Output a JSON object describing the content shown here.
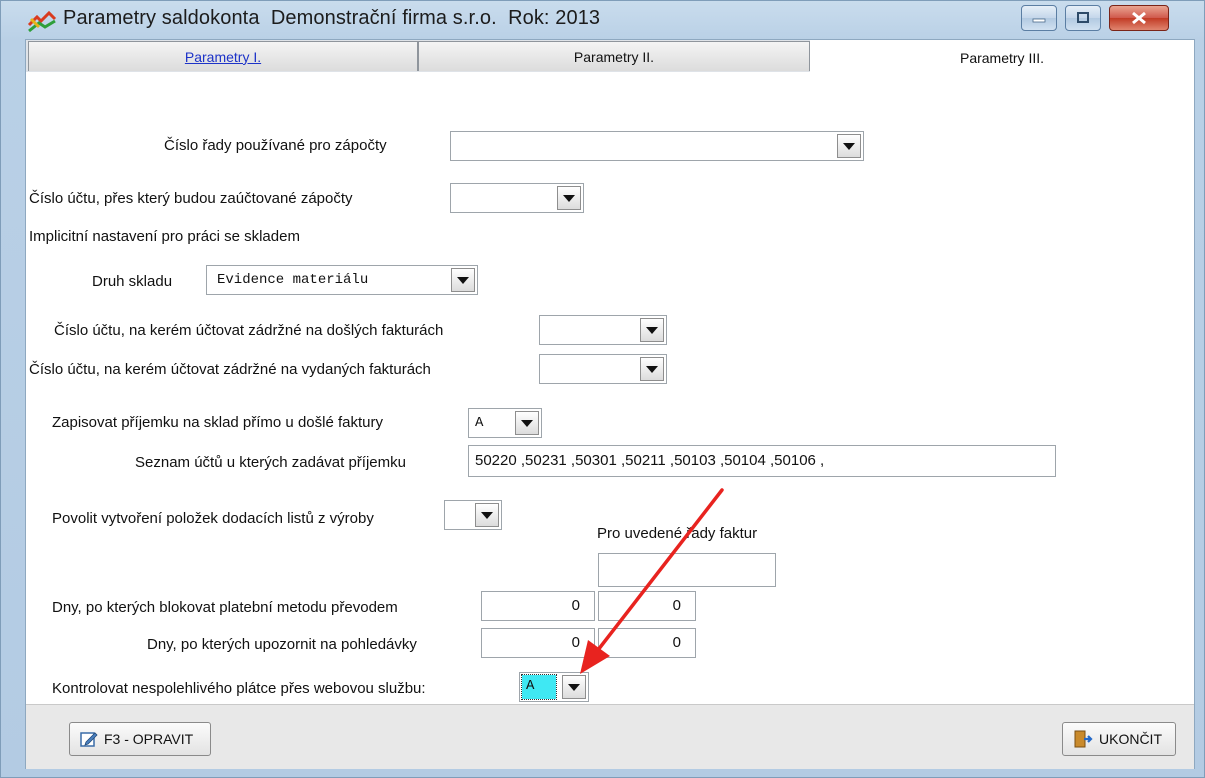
{
  "window": {
    "title": "Parametry saldokonta  Demonstrační firma s.r.o.  Rok: 2013",
    "accent_close": "#c23b25"
  },
  "tabs": [
    {
      "label": "Parametry I."
    },
    {
      "label": "Parametry II."
    },
    {
      "label": "Parametry III."
    }
  ],
  "form": {
    "rada_label": "Číslo řady používané pro zápočty",
    "rada_value": "",
    "ucet_zapocty_label": "Číslo účtu, přes který budou zaúčtované zápočty",
    "ucet_zapocty_value": "",
    "sklad_section": "Implicitní nastavení pro práci se skladem",
    "druh_skladu_label": "Druh skladu",
    "druh_skladu_value": "Evidence materiálu",
    "zadrzne_doslych_label": "Číslo účtu, na kerém účtovat zádržné na došlých fakturách",
    "zadrzne_doslych_value": "",
    "zadrzne_vydanych_label": "Číslo účtu, na kerém účtovat zádržné na vydaných fakturách",
    "zadrzne_vydanych_value": "",
    "prijemka_label": "Zapisovat příjemku na sklad přímo u došlé faktury",
    "prijemka_value": "A",
    "seznam_uctu_label": "Seznam účtů u kterých zadávat příjemku",
    "seznam_uctu_value": "50220 ,50231 ,50301 ,50211 ,50103 ,50104 ,50106 ,",
    "dodaci_listy_label": "Povolit vytvoření položek dodacích listů z výroby",
    "dodaci_listy_value": "",
    "rady_faktur_label": "Pro uvedené řady faktur",
    "rady_faktur_value": "",
    "blokovat_label": "Dny, po kterých blokovat platební metodu převodem",
    "blokovat_value_1": "0",
    "blokovat_value_2": "0",
    "upozornit_label": "Dny, po kterých upozornit na pohledávky",
    "upozornit_value_1": "0",
    "upozornit_value_2": "0",
    "kontrola_label": "Kontrolovat nespolehlivého plátce přes webovou službu:",
    "kontrola_value": "A",
    "kontrola_highlight": "#3fe8f3"
  },
  "buttons": {
    "edit_label": "F3 - OPRAVIT",
    "exit_label": "UKONČIT"
  },
  "annotation": {
    "arrow_color": "#e8231f"
  }
}
